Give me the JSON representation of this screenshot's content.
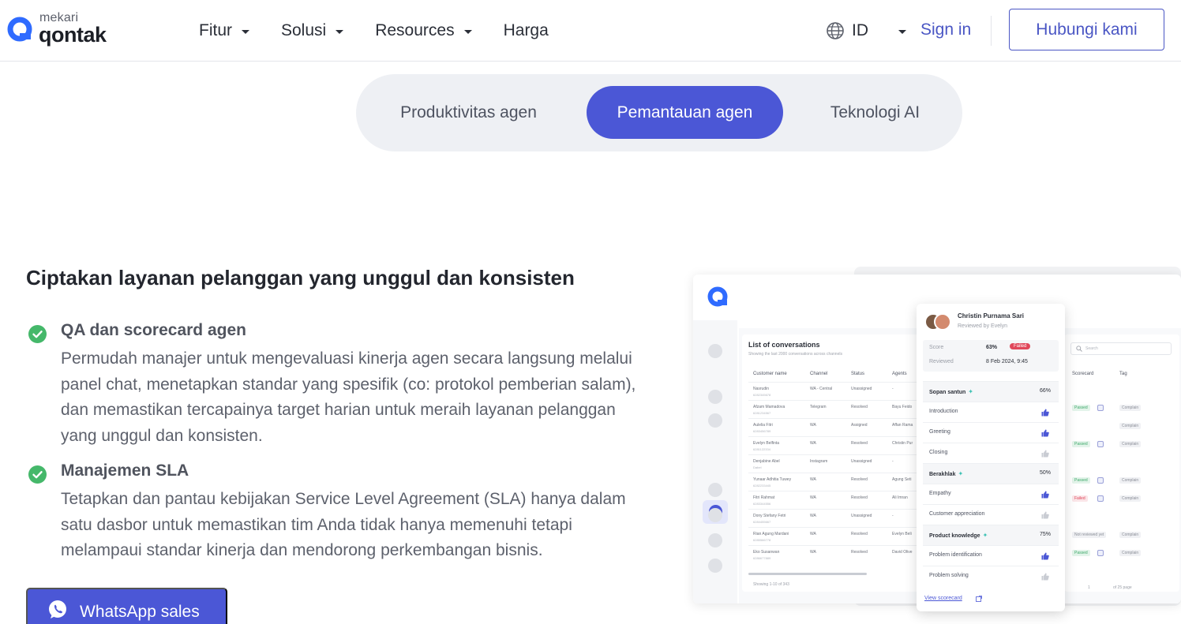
{
  "header": {
    "logo": {
      "small": "mekari",
      "big": "qontak"
    },
    "nav": [
      {
        "label": "Fitur",
        "has_caret": true
      },
      {
        "label": "Solusi",
        "has_caret": true
      },
      {
        "label": "Resources",
        "has_caret": true
      },
      {
        "label": "Harga",
        "has_caret": false
      }
    ],
    "language": "ID",
    "sign_in": "Sign in",
    "contact_button": "Hubungi kami"
  },
  "tabs": [
    {
      "label": "Produktivitas agen",
      "active": false
    },
    {
      "label": "Pemantauan agen",
      "active": true
    },
    {
      "label": "Teknologi AI",
      "active": false
    }
  ],
  "content": {
    "headline": "Ciptakan layanan pelanggan yang unggul dan konsisten",
    "features": [
      {
        "title": "QA dan scorecard agen",
        "description": "Permudah manajer untuk mengevaluasi kinerja agen secara langsung melalui panel chat, menetapkan standar yang spesifik (co: protokol pemberian salam), dan memastikan tercapainya target harian untuk meraih layanan pelanggan yang unggul dan konsisten."
      },
      {
        "title": "Manajemen SLA",
        "description": "Tetapkan dan pantau kebijakan Service Level Agreement (SLA) hanya dalam satu dasbor untuk memastikan tim Anda tidak hanya memenuhi tetapi melampaui standar kinerja dan mendorong perkembangan bisnis."
      }
    ],
    "whatsapp_button": "WhatsApp sales"
  },
  "mockup": {
    "list_title": "List of conversations",
    "list_subtitle": "Showing the last 2000 conversations across channels",
    "columns": [
      "Customer name",
      "Channel",
      "Status",
      "Agents"
    ],
    "rows": [
      {
        "name": "Nasrudin",
        "phone": "6282345678",
        "channel": "WA - Central",
        "status": "Unassigned",
        "agent": "-"
      },
      {
        "name": "Afzam Mamadova",
        "phone": "6281234567",
        "channel": "Telegram",
        "status": "Resolved",
        "agent": "Bayu Feido"
      },
      {
        "name": "Aulelia Fitri",
        "phone": "6283456789",
        "channel": "WA",
        "status": "Assigned",
        "agent": "Affan Rama"
      },
      {
        "name": "Evelyn Belfinta",
        "phone": "6281122334",
        "channel": "WA",
        "status": "Resolved",
        "agent": "Christin Pur"
      },
      {
        "name": "Denjabine Abel",
        "phone": "Dabel",
        "channel": "Instagram",
        "status": "Unassigned",
        "agent": "-"
      },
      {
        "name": "Yunaar Adhitia Tuwey",
        "phone": "6282233445",
        "channel": "WA",
        "status": "Resolved",
        "agent": "Agung Seti"
      },
      {
        "name": "Fitri Rahmat",
        "phone": "6283344556",
        "channel": "WA",
        "status": "Resolved",
        "agent": "Ali Imran"
      },
      {
        "name": "Dony Stefany Fetri",
        "phone": "6284455667",
        "channel": "WA",
        "status": "Unassigned",
        "agent": "-"
      },
      {
        "name": "Rian Agung Mardani",
        "phone": "6285566778",
        "channel": "WA",
        "status": "Resolved",
        "agent": "Evelyn Beli"
      },
      {
        "name": "Eko Susanwan",
        "phone": "6286677889",
        "channel": "WA",
        "status": "Resolved",
        "agent": "David Olive"
      }
    ],
    "list_footer": "Showing 1-10 of 343",
    "search_placeholder": "Search",
    "right_columns": [
      "Scorecard",
      "Tag"
    ],
    "right_rows": [
      {
        "score": "",
        "tag": ""
      },
      {
        "score": "Passed",
        "tag": "Complain"
      },
      {
        "score": "",
        "tag": "Complain"
      },
      {
        "score": "Passed",
        "tag": "Complain"
      },
      {
        "score": "",
        "tag": ""
      },
      {
        "score": "Passed",
        "tag": "Complain"
      },
      {
        "score": "Failed",
        "tag": "Complain"
      },
      {
        "score": "",
        "tag": ""
      },
      {
        "score": "Not reviewed yet",
        "tag": "Complain"
      },
      {
        "score": "Passed",
        "tag": "Complain"
      }
    ],
    "pager": "of 25 page",
    "pager_current": "1",
    "popup": {
      "agent_name": "Christin Purnama Sari",
      "reviewed_by": "Reviewed by Evelyn",
      "score_label": "Score",
      "score_value": "63%",
      "score_badge": "Failed",
      "reviewed_label": "Reviewed",
      "reviewed_value": "8 Feb 2024, 9:45",
      "items": [
        {
          "label": "Sopan santun",
          "value": "66%",
          "section": true
        },
        {
          "label": "Introduction",
          "value": "",
          "section": false,
          "thumb": "up"
        },
        {
          "label": "Greeting",
          "value": "",
          "section": false,
          "thumb": "up"
        },
        {
          "label": "Closing",
          "value": "",
          "section": false,
          "thumb": "down"
        },
        {
          "label": "Berakhlak",
          "value": "50%",
          "section": true
        },
        {
          "label": "Empathy",
          "value": "",
          "section": false,
          "thumb": "up"
        },
        {
          "label": "Customer appreciation",
          "value": "",
          "section": false,
          "thumb": "down"
        },
        {
          "label": "Product knowledge",
          "value": "75%",
          "section": true
        },
        {
          "label": "Problem identification",
          "value": "",
          "section": false,
          "thumb": "up"
        },
        {
          "label": "Problem solving",
          "value": "",
          "section": false,
          "thumb": "down"
        }
      ],
      "link": "View scorecard"
    }
  },
  "colors": {
    "accent": "#4b57d6",
    "link": "#4a56c4",
    "check": "#45b86a",
    "fail": "#e0475a"
  },
  "icons": {
    "globe": "globe-icon",
    "check": "check-circle-icon",
    "whatsapp": "whatsapp-icon",
    "caret": "chevron-down-icon"
  }
}
